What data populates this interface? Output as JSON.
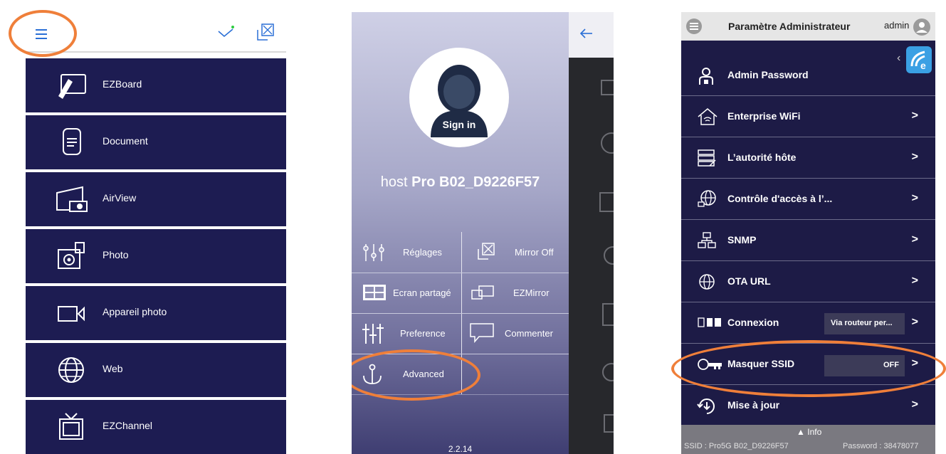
{
  "panel1": {
    "menu_icon": "hamburger-icon",
    "check_icon": "checkmark-icon",
    "mirror_icon": "mirror-icon",
    "items": [
      {
        "label": "EZBoard",
        "icon": "pen-board-icon"
      },
      {
        "label": "Document",
        "icon": "document-icon"
      },
      {
        "label": "AirView",
        "icon": "airview-icon"
      },
      {
        "label": "Photo",
        "icon": "photo-icon"
      },
      {
        "label": "Appareil photo",
        "icon": "camera-icon"
      },
      {
        "label": "Web",
        "icon": "globe-icon"
      },
      {
        "label": "EZChannel",
        "icon": "tv-icon"
      }
    ]
  },
  "panel2": {
    "avatar_label": "Sign in",
    "host_prefix": "host",
    "host_name": "Pro B02_D9226F57",
    "grid": [
      {
        "label": "Réglages",
        "icon": "sliders-icon"
      },
      {
        "label": "Mirror Off",
        "icon": "mirror-icon"
      },
      {
        "label": "Ecran partagé",
        "icon": "split-screen-icon"
      },
      {
        "label": "EZMirror",
        "icon": "ezmirror-icon"
      },
      {
        "label": "Preference",
        "icon": "equalizer-icon"
      },
      {
        "label": "Commenter",
        "icon": "comment-icon"
      },
      {
        "label": "Advanced",
        "icon": "anchor-icon"
      }
    ],
    "version": "2.2.14",
    "back_icon": "arrow-left-icon"
  },
  "panel3": {
    "title": "Paramètre Administrateur",
    "user": "admin",
    "rows": [
      {
        "label": "Admin Password",
        "icon": "key-user-icon"
      },
      {
        "label": "Enterprise WiFi",
        "icon": "house-wifi-icon"
      },
      {
        "label": "L’autorité hôte",
        "icon": "server-icon"
      },
      {
        "label": "Contrôle d'accès à l’...",
        "icon": "globe-network-icon"
      },
      {
        "label": "SNMP",
        "icon": "network-icon"
      },
      {
        "label": "OTA URL",
        "icon": "globe-icon"
      },
      {
        "label": "Connexion",
        "icon": "connection-icon",
        "value": "Via routeur per..."
      },
      {
        "label": "Masquer SSID",
        "icon": "key-icon",
        "value": "OFF"
      },
      {
        "label": "Mise à jour",
        "icon": "update-icon"
      }
    ],
    "info_label": "Info",
    "ssid": "SSID : Pro5G B02_D9226F57",
    "password": "Password : 38478077",
    "accent": "#ef7f3a"
  }
}
